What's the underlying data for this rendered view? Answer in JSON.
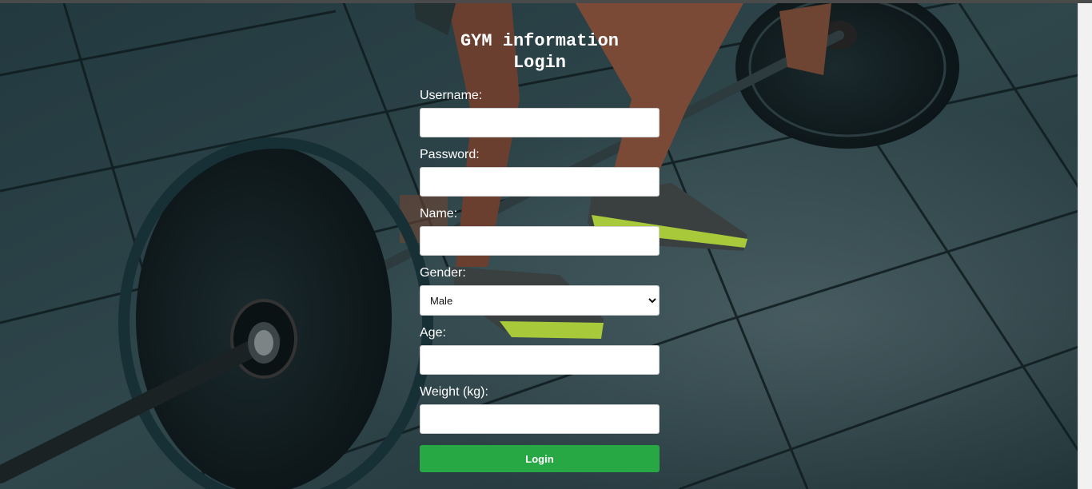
{
  "page": {
    "title": "GYM information\nLogin",
    "background": "gym-deadlift-photo",
    "colors": {
      "button": "#28a745",
      "text": "#ffffff",
      "floor": "#2b3d42"
    }
  },
  "form": {
    "username_label": "Username:",
    "username_value": "",
    "password_label": "Password:",
    "password_value": "",
    "name_label": "Name:",
    "name_value": "",
    "gender_label": "Gender:",
    "gender_selected": "Male",
    "age_label": "Age:",
    "age_value": "",
    "weight_label": "Weight (kg):",
    "weight_value": "",
    "submit_label": "Login"
  }
}
